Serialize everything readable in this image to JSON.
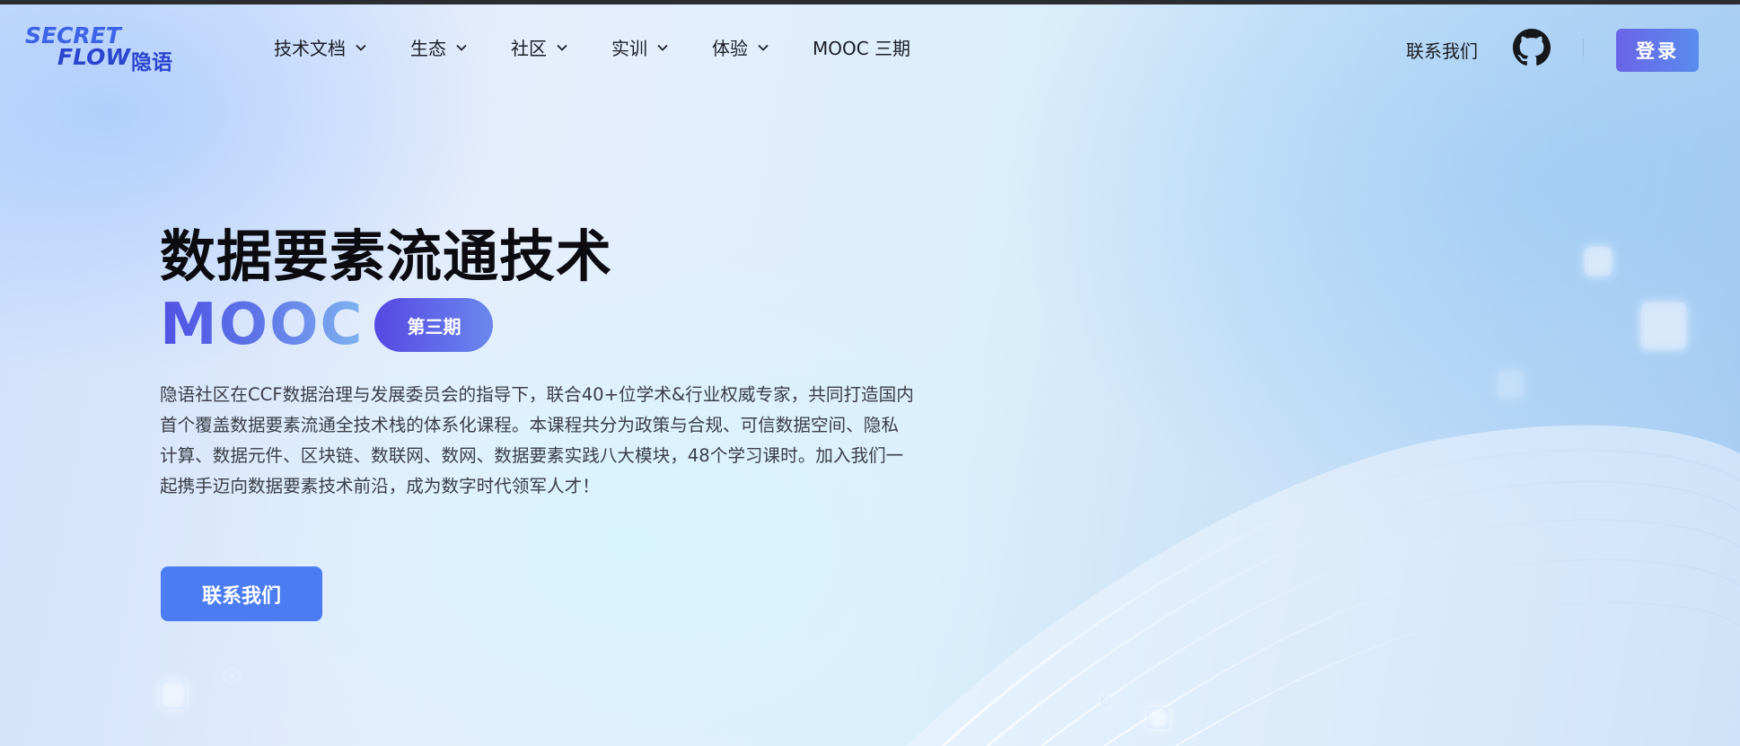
{
  "logo": {
    "line1": "SECRET",
    "line2": "FLOW",
    "cn": "隐语"
  },
  "nav": {
    "items": [
      {
        "label": "技术文档",
        "has_dropdown": true
      },
      {
        "label": "生态",
        "has_dropdown": true
      },
      {
        "label": "社区",
        "has_dropdown": true
      },
      {
        "label": "实训",
        "has_dropdown": true
      },
      {
        "label": "体验",
        "has_dropdown": true
      },
      {
        "label": "MOOC 三期",
        "has_dropdown": false
      }
    ],
    "contact_label": "联系我们",
    "github_icon": "github-icon",
    "login_label": "登录"
  },
  "hero": {
    "title": "数据要素流通技术",
    "mooc": "MOOC",
    "badge": "第三期",
    "description_lines": [
      "隐语社区在CCF数据治理与发展委员会的指导下，联合40+位学术&行业权威专家，共同打造国内",
      "首个覆盖数据要素流通全技术栈的体系化课程。本课程共分为政策与合规、可信数据空间、隐私",
      "计算、数据元件、区块链、数联网、数网、数据要素实践八大模块，48个学习课时。加入我们一",
      "起携手迈向数据要素技术前沿，成为数字时代领军人才！"
    ],
    "cta_label": "联系我们"
  },
  "colors": {
    "accent": "#4b7cf2",
    "login_gradient_start": "#6a64e6",
    "login_gradient_end": "#5a8cee",
    "mooc_gradient_start": "#4f52e3",
    "mooc_gradient_end": "#7fb4f0"
  }
}
